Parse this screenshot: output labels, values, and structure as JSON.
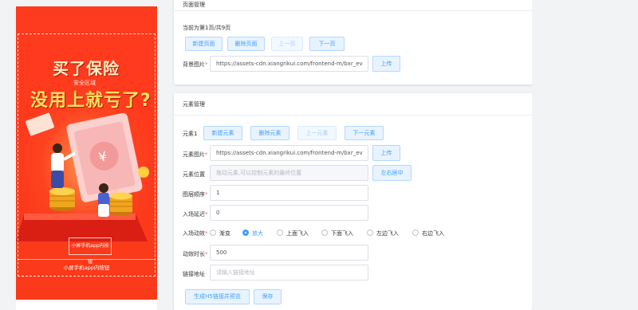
{
  "preview": {
    "title_line1": "买了保险",
    "title_line2": "没用上就亏了?",
    "safe_area_label": "安全区域",
    "element_box_label": "小屏手机app内按钮",
    "bottom_label": "小屏手机app内按钮"
  },
  "page_section": {
    "title": "页面管理",
    "page_info": "当前为第1页/共9页",
    "buttons": {
      "new": "新建页面",
      "delete": "删除页面",
      "prev": "上一页",
      "next": "下一页"
    },
    "bg_label": "背景图片",
    "bg_value": "https://assets-cdn.xiangrikui.com/frontend-m/bxr_ev",
    "upload": "上传"
  },
  "element_section": {
    "title": "元素管理",
    "element_name": "元素1",
    "buttons": {
      "new": "新建元素",
      "delete": "删除元素",
      "prev": "上一元素",
      "next": "下一元素"
    },
    "image_label": "元素图片",
    "image_value": "https://assets-cdn.xiangrikui.com/frontend-m/bxr_ev",
    "upload": "上传",
    "position_label": "元素位置",
    "position_placeholder": "拖动元素,可以控制元素的最终位置",
    "center_button": "左右居中",
    "layer_label": "图层顺序",
    "layer_value": "1",
    "delay_label": "入场延迟",
    "delay_value": "0",
    "anim_label": "入场动效",
    "anim_options": [
      "渐变",
      "放大",
      "上面飞入",
      "下面飞入",
      "左边飞入",
      "右边飞入"
    ],
    "anim_selected": "放大",
    "duration_label": "动效时长",
    "duration_value": "500",
    "link_label": "链接地址",
    "link_placeholder": "请输入链接地址",
    "generate_button": "生成H5链接并预览",
    "save_button": "保存"
  },
  "colors": {
    "primary": "#409eff",
    "poster_red": "#ff3b1f",
    "required": "#f56c6c"
  }
}
